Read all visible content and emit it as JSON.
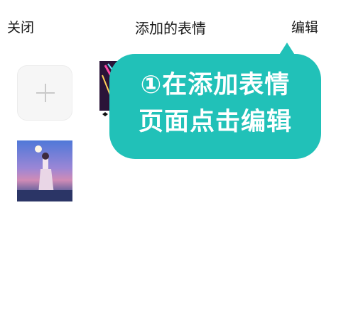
{
  "header": {
    "close_label": "关闭",
    "title": "添加的表情",
    "edit_label": "编辑"
  },
  "tooltip": {
    "line1": "①在添加表情",
    "line2": "页面点击编辑",
    "color": "#21c1b8"
  },
  "grid": {
    "add_icon": "plus-icon",
    "stickers": [
      {
        "name": "sticker-neon"
      },
      {
        "name": "sticker-anime-night"
      }
    ]
  }
}
